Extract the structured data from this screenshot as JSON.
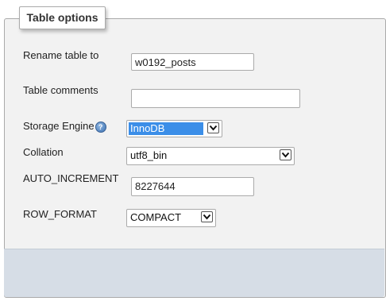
{
  "panel": {
    "legend": "Table options"
  },
  "fields": {
    "rename": {
      "label": "Rename table to",
      "value": "w0192_posts"
    },
    "comments": {
      "label": "Table comments",
      "value": ""
    },
    "engine": {
      "label": "Storage Engine",
      "value": "InnoDB",
      "help_icon": "help-icon"
    },
    "collation": {
      "label": "Collation",
      "value": "utf8_bin"
    },
    "auto_increment": {
      "label": "AUTO_INCREMENT",
      "value": "8227644"
    },
    "row_format": {
      "label": "ROW_FORMAT",
      "value": "COMPACT"
    }
  }
}
